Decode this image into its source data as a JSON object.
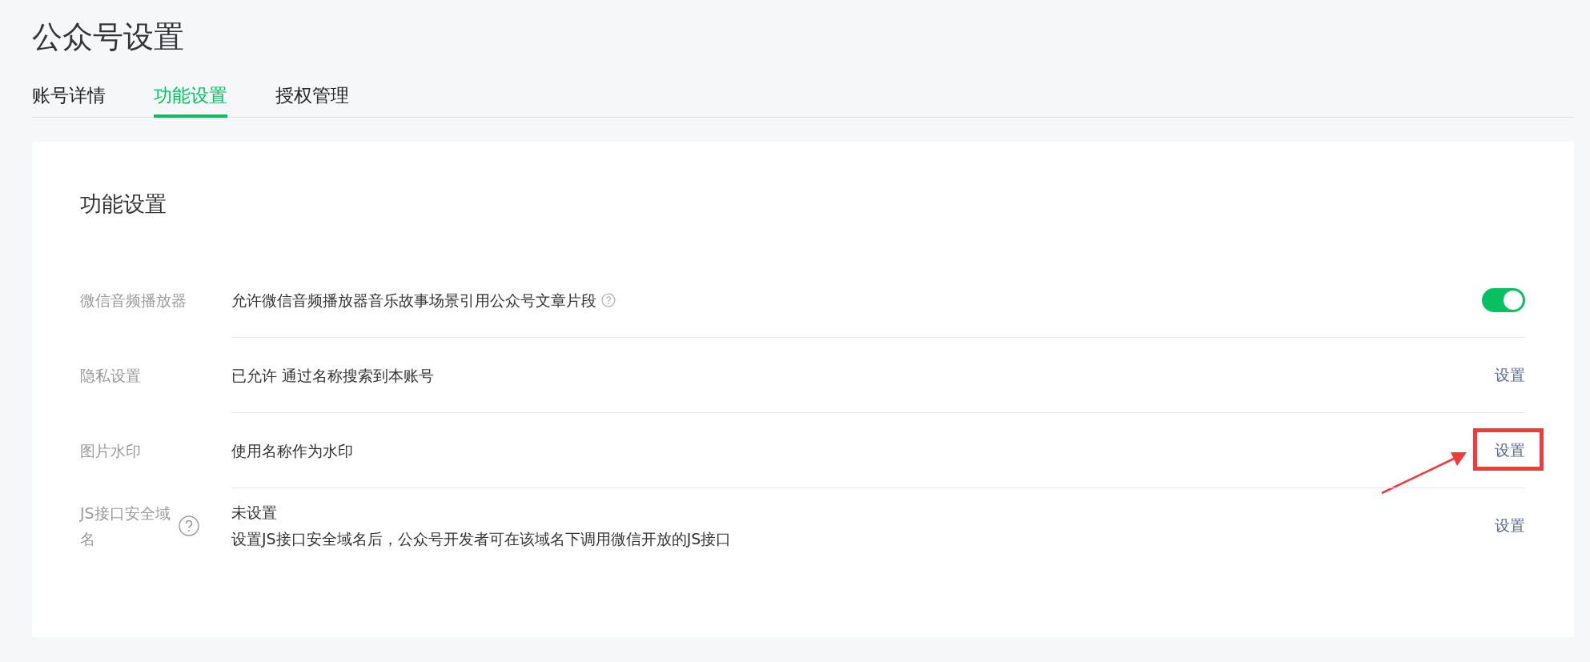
{
  "page_title": "公众号设置",
  "tabs": [
    {
      "label": "账号详情",
      "selected": false
    },
    {
      "label": "功能设置",
      "selected": true
    },
    {
      "label": "授权管理",
      "selected": false
    }
  ],
  "card": {
    "heading": "功能设置",
    "rows": [
      {
        "kind": "toggle",
        "label": "微信音频播放器",
        "label_help": false,
        "lines": [
          "允许微信音频播放器音乐故事场景引用公众号文章片段"
        ],
        "text_help": true,
        "on": true
      },
      {
        "kind": "link",
        "label": "隐私设置",
        "label_help": false,
        "lines": [
          "已允许 通过名称搜索到本账号"
        ],
        "text_help": false,
        "action": "设置",
        "highlighted": false
      },
      {
        "kind": "link",
        "label": "图片水印",
        "label_help": false,
        "lines": [
          "使用名称作为水印"
        ],
        "text_help": false,
        "action": "设置",
        "highlighted": true
      },
      {
        "kind": "link",
        "label": "JS接口安全域名",
        "label_help": true,
        "lines": [
          "未设置",
          "设置JS接口安全域名后，公众号开发者可在该域名下调用微信开放的JS接口"
        ],
        "text_help": false,
        "action": "设置",
        "highlighted": false
      }
    ]
  }
}
